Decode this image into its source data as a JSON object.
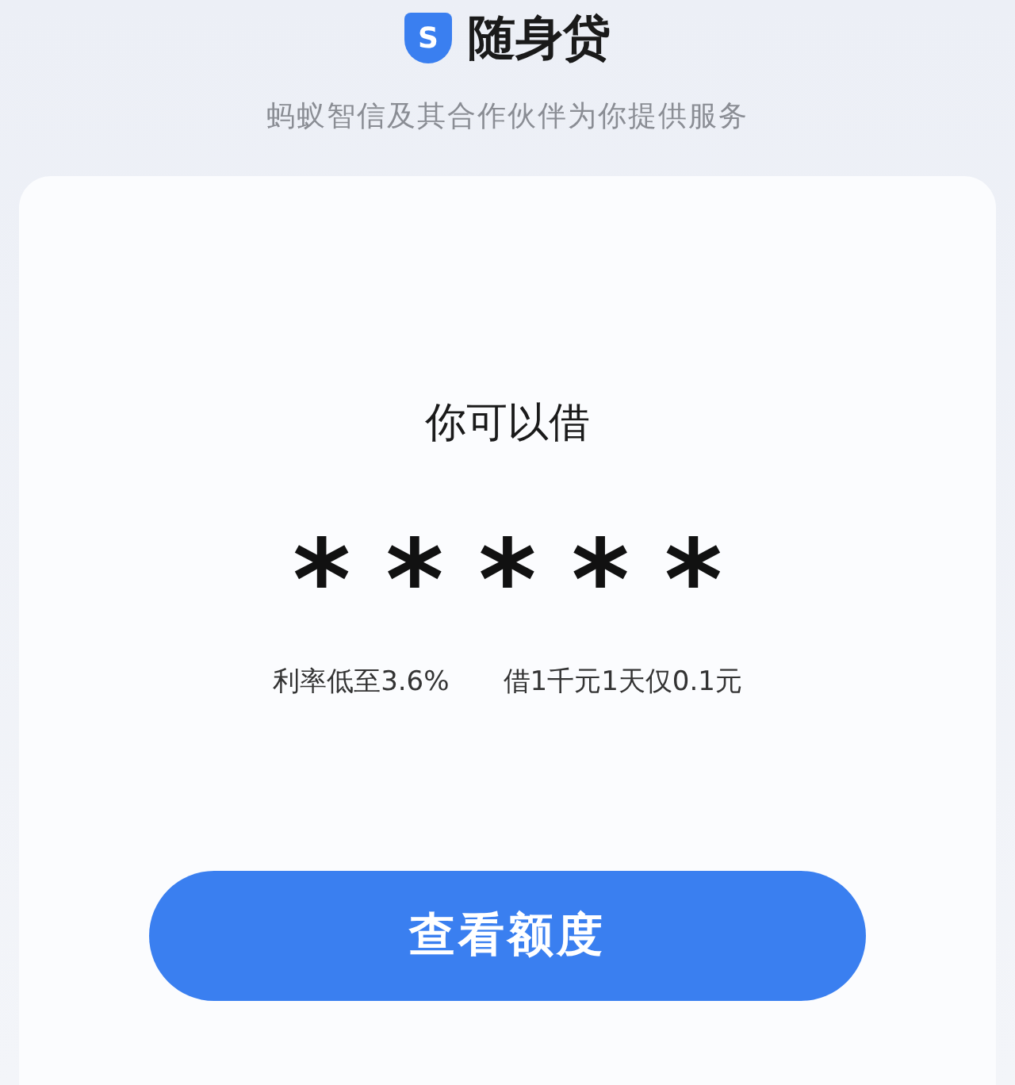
{
  "header": {
    "logo_letter": "S",
    "brand": "随身贷",
    "subtitle": "蚂蚁智信及其合作伙伴为你提供服务"
  },
  "card": {
    "title": "你可以借",
    "amount_mask": "*****",
    "rates": [
      "利率低至3.6%",
      "借1千元1天仅0.1元"
    ]
  },
  "button": {
    "label": "查看额度"
  }
}
